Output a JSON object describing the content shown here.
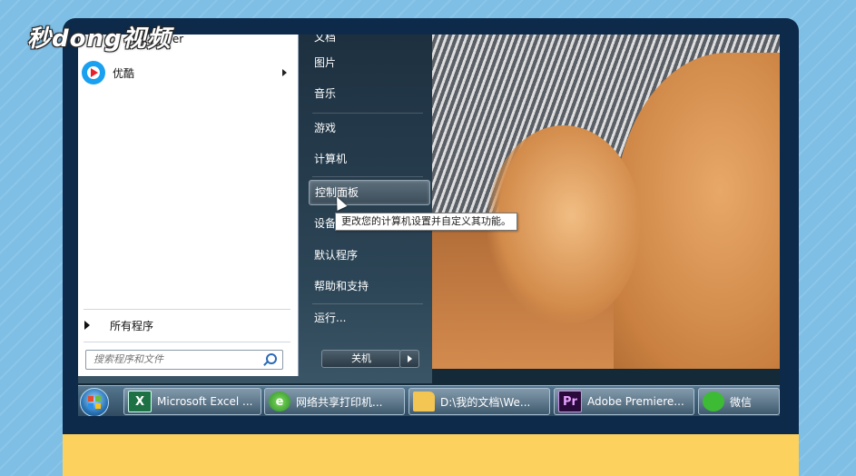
{
  "watermark": "秒dong视频",
  "start_menu": {
    "programs": [
      {
        "label": "Windows Media Player",
        "visible_text": "me Player"
      },
      {
        "label": "优酷",
        "has_submenu": true
      }
    ],
    "all_programs": "所有程序",
    "search_placeholder": "搜索程序和文件",
    "right_items": [
      {
        "label": "文档"
      },
      {
        "label": "图片"
      },
      {
        "label": "音乐"
      },
      {
        "label": "游戏"
      },
      {
        "label": "计算机"
      },
      {
        "label": "控制面板",
        "highlighted": true
      },
      {
        "label": "设备和打印机"
      },
      {
        "label": "默认程序"
      },
      {
        "label": "帮助和支持"
      },
      {
        "label": "运行..."
      }
    ],
    "shutdown_label": "关机",
    "tooltip": "更改您的计算机设置并自定义其功能。"
  },
  "taskbar": {
    "buttons": [
      {
        "icon": "excel-icon",
        "label": "Microsoft Excel ..."
      },
      {
        "icon": "ie-icon",
        "label": "网络共享打印机..."
      },
      {
        "icon": "folder-icon",
        "label": "D:\\我的文档\\We..."
      },
      {
        "icon": "premiere-icon",
        "label": "Adobe Premiere..."
      },
      {
        "icon": "wechat-icon",
        "label": "微信"
      }
    ]
  },
  "colors": {
    "background": "#7fbfe6",
    "monitor_frame": "#0d2a4a",
    "stand": "#fdd15d",
    "youku_blue": "#1aa0f0"
  }
}
